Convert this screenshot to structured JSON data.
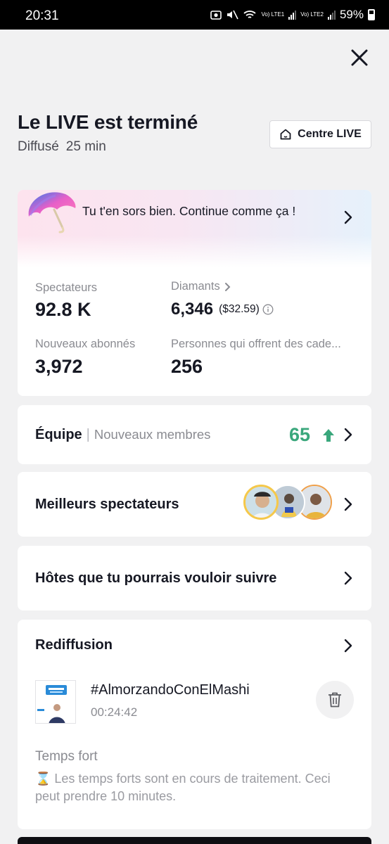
{
  "status_bar": {
    "time": "20:31",
    "sim1": "Vo) LTE1",
    "sim2": "Vo) LTE2",
    "battery": "59%"
  },
  "header": {
    "title": "Le LIVE est terminé",
    "broadcast_label": "Diffusé",
    "duration": "25 min",
    "centre_live_label": "Centre LIVE"
  },
  "banner": {
    "message": "Tu t'en sors bien. Continue comme ça !"
  },
  "stats": {
    "viewers_label": "Spectateurs",
    "viewers_value": "92.8 K",
    "diamonds_label": "Diamants",
    "diamonds_value": "6,346",
    "diamonds_dollar": "($32.59)",
    "new_followers_label": "Nouveaux abonnés",
    "new_followers_value": "3,972",
    "gifters_label": "Personnes qui offrent des cade...",
    "gifters_value": "256"
  },
  "team": {
    "label": "Équipe",
    "separator": "|",
    "sub_label": "Nouveaux membres",
    "count": "65",
    "accent_color": "#3aa77c"
  },
  "top_viewers": {
    "label": "Meilleurs spectateurs"
  },
  "hosts": {
    "label": "Hôtes que tu pourrais vouloir suivre"
  },
  "replay": {
    "label": "Rediffusion",
    "video_title": "#AlmorzandoConElMashi",
    "video_duration": "00:24:42",
    "highlights_label": "Temps fort",
    "highlights_note": "⌛ Les temps forts sont en cours de traitement. Ceci peut prendre 10 minutes."
  },
  "icons": [
    "close-icon",
    "home-icon",
    "chevron-right-icon",
    "info-icon",
    "arrow-up-icon",
    "trash-icon",
    "umbrella-icon"
  ]
}
